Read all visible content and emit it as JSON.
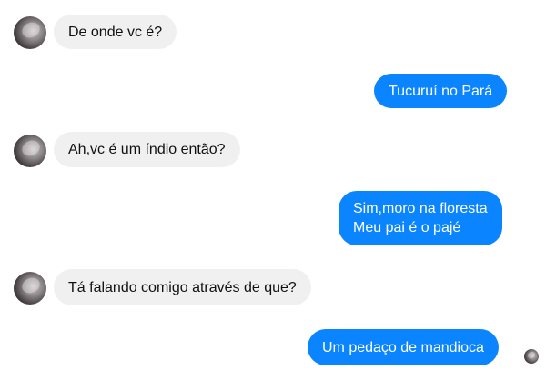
{
  "messages": [
    {
      "direction": "incoming",
      "text": "De onde vc é?"
    },
    {
      "direction": "outgoing",
      "text": "Tucuruí no Pará"
    },
    {
      "direction": "incoming",
      "text": "Ah,vc é um índio então?"
    },
    {
      "direction": "outgoing",
      "lines": [
        "Sim,moro na floresta",
        "Meu pai é o pajé"
      ]
    },
    {
      "direction": "incoming",
      "text": "Tá falando comigo através de que?"
    },
    {
      "direction": "outgoing",
      "text": "Um pedaço de mandioca"
    }
  ],
  "colors": {
    "outgoing_bubble": "#0a84ff",
    "incoming_bubble": "#f0f0f0",
    "background": "#ffffff"
  },
  "icons": {
    "avatar": "contact-avatar-icon",
    "seen": "seen-avatar-icon"
  }
}
